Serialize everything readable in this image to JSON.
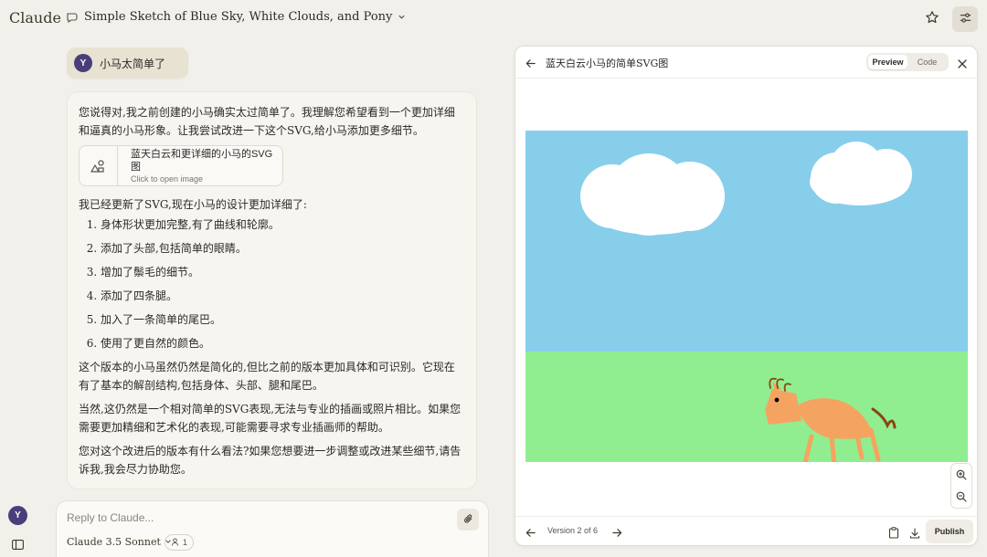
{
  "app": {
    "logo": "Claude"
  },
  "header": {
    "chat_title": "Simple Sketch of Blue Sky, White Clouds, and Pony"
  },
  "user": {
    "initial": "Y",
    "message": "小马太简单了"
  },
  "assistant": {
    "intro": "您说得对,我之前创建的小马确实太过简单了。我理解您希望看到一个更加详细和逼真的小马形象。让我尝试改进一下这个SVG,给小马添加更多细节。",
    "artifact_card": {
      "title": "蓝天白云和更详细的小马的SVG图",
      "subtitle": "Click to open image"
    },
    "updated": "我已经更新了SVG,现在小马的设计更加详细了:",
    "list": [
      "身体形状更加完整,有了曲线和轮廓。",
      "添加了头部,包括简单的眼睛。",
      "增加了鬃毛的细节。",
      "添加了四条腿。",
      "加入了一条简单的尾巴。",
      "使用了更自然的颜色。"
    ],
    "p2": "这个版本的小马虽然仍然是简化的,但比之前的版本更加具体和可识别。它现在有了基本的解剖结构,包括身体、头部、腿和尾巴。",
    "p3": "当然,这仍然是一个相对简单的SVG表现,无法与专业的插画或照片相比。如果您需要更加精细和艺术化的表现,可能需要寻求专业插画师的帮助。",
    "p4": "您对这个改进后的版本有什么看法?如果您想要进一步调整或改进某些细节,请告诉我,我会尽力协助您。"
  },
  "reply": {
    "placeholder": "Reply to Claude...",
    "model": "Claude 3.5 Sonnet",
    "style_count": "1"
  },
  "panel": {
    "title": "蓝天白云小马的简单SVG图",
    "tabs": [
      "Preview",
      "Code"
    ],
    "active_tab": "Preview",
    "version": "Version 2 of 6",
    "publish": "Publish"
  },
  "colors": {
    "sky": "#87ceeb",
    "grass": "#90ee90",
    "pony": "#f4a460",
    "mane": "#8b4513",
    "avatar": "#4a3f7a"
  },
  "icons": [
    "chat-icon",
    "chevron-down-icon",
    "star-icon",
    "sliders-icon",
    "sidebar-icon",
    "image-icon",
    "paperclip-icon",
    "arrow-left-icon",
    "close-icon",
    "zoom-in-icon",
    "zoom-out-icon",
    "arrow-right-icon",
    "copy-icon",
    "download-icon"
  ]
}
